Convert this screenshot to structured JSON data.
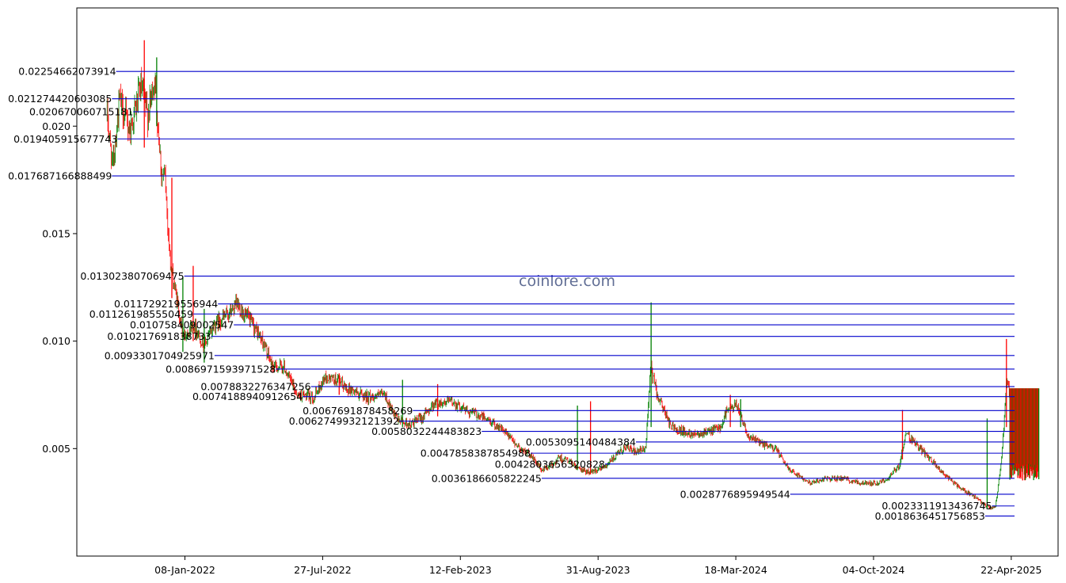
{
  "chart_data": {
    "type": "candlestick",
    "watermark": "coinlore.com",
    "colors": {
      "up": "#008000",
      "down": "#ff0000",
      "level": "#0000cc",
      "axis": "#000000"
    },
    "x_start": "2021-09-17",
    "x_end": "2025-06-01",
    "xlim": [
      "2021-08-04",
      "2025-06-29"
    ],
    "ylim": [
      0.0,
      0.0255
    ],
    "grid": false,
    "x_ticks": [
      {
        "date": "2022-01-08",
        "label": "08-Jan-2022"
      },
      {
        "date": "2022-07-27",
        "label": "27-Jul-2022"
      },
      {
        "date": "2023-02-12",
        "label": "12-Feb-2023"
      },
      {
        "date": "2023-08-31",
        "label": "31-Aug-2023"
      },
      {
        "date": "2024-03-18",
        "label": "18-Mar-2024"
      },
      {
        "date": "2024-10-04",
        "label": "04-Oct-2024"
      },
      {
        "date": "2025-04-22",
        "label": "22-Apr-2025"
      }
    ],
    "y_ticks": [
      {
        "value": 0.005,
        "label": "0.005"
      },
      {
        "value": 0.01,
        "label": "0.010"
      },
      {
        "value": 0.015,
        "label": "0.015"
      },
      {
        "value": 0.02,
        "label": "0.020"
      }
    ],
    "price_path": [
      [
        "2021-09-17",
        0.0205
      ],
      [
        "2021-09-25",
        0.0181
      ],
      [
        "2021-10-05",
        0.0212
      ],
      [
        "2021-10-20",
        0.0198
      ],
      [
        "2021-11-05",
        0.0218
      ],
      [
        "2021-11-15",
        0.0205
      ],
      [
        "2021-11-25",
        0.0222
      ],
      [
        "2021-12-05",
        0.0178
      ],
      [
        "2021-12-10",
        0.0176
      ],
      [
        "2021-12-18",
        0.0135
      ],
      [
        "2021-12-28",
        0.0118
      ],
      [
        "2022-01-05",
        0.0102
      ],
      [
        "2022-01-20",
        0.0108
      ],
      [
        "2022-02-05",
        0.0098
      ],
      [
        "2022-02-20",
        0.0108
      ],
      [
        "2022-03-10",
        0.0112
      ],
      [
        "2022-03-25",
        0.0117
      ],
      [
        "2022-04-15",
        0.0108
      ],
      [
        "2022-05-01",
        0.01
      ],
      [
        "2022-05-15",
        0.0088
      ],
      [
        "2022-06-01",
        0.0088
      ],
      [
        "2022-06-20",
        0.0075
      ],
      [
        "2022-07-15",
        0.0074
      ],
      [
        "2022-07-30",
        0.0083
      ],
      [
        "2022-08-15",
        0.0082
      ],
      [
        "2022-09-01",
        0.0078
      ],
      [
        "2022-10-01",
        0.0074
      ],
      [
        "2022-10-25",
        0.0075
      ],
      [
        "2022-11-10",
        0.0064
      ],
      [
        "2022-12-01",
        0.0061
      ],
      [
        "2022-12-20",
        0.0065
      ],
      [
        "2023-01-05",
        0.0071
      ],
      [
        "2023-01-30",
        0.0072
      ],
      [
        "2023-02-20",
        0.0068
      ],
      [
        "2023-03-15",
        0.0065
      ],
      [
        "2023-04-10",
        0.006
      ],
      [
        "2023-04-25",
        0.0055
      ],
      [
        "2023-05-10",
        0.005
      ],
      [
        "2023-05-25",
        0.0047
      ],
      [
        "2023-06-10",
        0.004
      ],
      [
        "2023-06-25",
        0.0042
      ],
      [
        "2023-07-05",
        0.0046
      ],
      [
        "2023-07-20",
        0.0044
      ],
      [
        "2023-08-05",
        0.004
      ],
      [
        "2023-08-20",
        0.0039
      ],
      [
        "2023-09-10",
        0.0042
      ],
      [
        "2023-09-25",
        0.0046
      ],
      [
        "2023-10-10",
        0.0051
      ],
      [
        "2023-10-25",
        0.0048
      ],
      [
        "2023-11-08",
        0.005
      ],
      [
        "2023-11-15",
        0.0088
      ],
      [
        "2023-11-25",
        0.0075
      ],
      [
        "2023-12-15",
        0.006
      ],
      [
        "2024-01-10",
        0.0057
      ],
      [
        "2024-02-10",
        0.0058
      ],
      [
        "2024-02-25",
        0.006
      ],
      [
        "2024-03-05",
        0.0068
      ],
      [
        "2024-03-20",
        0.007
      ],
      [
        "2024-04-05",
        0.0056
      ],
      [
        "2024-04-25",
        0.0052
      ],
      [
        "2024-05-15",
        0.005
      ],
      [
        "2024-05-30",
        0.0042
      ],
      [
        "2024-06-15",
        0.0038
      ],
      [
        "2024-07-05",
        0.0034
      ],
      [
        "2024-07-25",
        0.0036
      ],
      [
        "2024-08-20",
        0.0036
      ],
      [
        "2024-09-15",
        0.0034
      ],
      [
        "2024-10-10",
        0.0034
      ],
      [
        "2024-10-25",
        0.0036
      ],
      [
        "2024-11-10",
        0.0042
      ],
      [
        "2024-11-20",
        0.0057
      ],
      [
        "2024-12-05",
        0.0052
      ],
      [
        "2024-12-25",
        0.0045
      ],
      [
        "2025-01-15",
        0.0038
      ],
      [
        "2025-02-05",
        0.0032
      ],
      [
        "2025-02-25",
        0.0028
      ],
      [
        "2025-03-10",
        0.0025
      ],
      [
        "2025-03-22",
        0.0022
      ],
      [
        "2025-03-30",
        0.0023
      ],
      [
        "2025-04-08",
        0.0045
      ],
      [
        "2025-04-15",
        0.008
      ],
      [
        "2025-04-25",
        0.0072
      ],
      [
        "2025-05-10",
        0.006
      ],
      [
        "2025-05-25",
        0.004
      ],
      [
        "2025-06-01",
        0.0038
      ]
    ],
    "spikes": [
      {
        "date": "2021-11-10",
        "low": 0.019,
        "high": 0.024
      },
      {
        "date": "2021-11-28",
        "low": 0.02,
        "high": 0.0232
      },
      {
        "date": "2021-12-20",
        "low": 0.012,
        "high": 0.0176
      },
      {
        "date": "2022-01-05",
        "low": 0.0095,
        "high": 0.013
      },
      {
        "date": "2022-01-20",
        "low": 0.01,
        "high": 0.0135
      },
      {
        "date": "2022-02-05",
        "low": 0.009,
        "high": 0.0115
      },
      {
        "date": "2022-08-20",
        "low": 0.0075,
        "high": 0.0085
      },
      {
        "date": "2022-11-20",
        "low": 0.006,
        "high": 0.0082
      },
      {
        "date": "2023-01-10",
        "low": 0.0065,
        "high": 0.008
      },
      {
        "date": "2023-08-01",
        "low": 0.004,
        "high": 0.007
      },
      {
        "date": "2023-08-20",
        "low": 0.0038,
        "high": 0.0072
      },
      {
        "date": "2023-11-16",
        "low": 0.006,
        "high": 0.0118
      },
      {
        "date": "2024-03-10",
        "low": 0.006,
        "high": 0.0075
      },
      {
        "date": "2024-03-25",
        "low": 0.006,
        "high": 0.0073
      },
      {
        "date": "2024-11-15",
        "low": 0.0045,
        "high": 0.0068
      },
      {
        "date": "2025-03-18",
        "low": 0.0022,
        "high": 0.0064
      },
      {
        "date": "2025-04-15",
        "low": 0.006,
        "high": 0.0101
      }
    ],
    "band": {
      "start": "2025-04-20",
      "end": "2025-06-01",
      "low": 0.0035,
      "high": 0.0078
    },
    "levels": [
      {
        "value": 0.02254662073914,
        "label": "0.02254662073914",
        "label_end": "2021-09-30"
      },
      {
        "value": 0.021274420603085,
        "label": "0.021274420603085",
        "label_end": "2021-09-24"
      },
      {
        "value": 0.020670060715181,
        "label": "0.020670060715181",
        "label_end": "2021-10-25"
      },
      {
        "value": 0.019405915677743,
        "label": "0.019405915677743",
        "label_end": "2021-10-02"
      },
      {
        "value": 0.017687166888499,
        "label": "0.017687166888499",
        "label_end": "2021-09-24"
      },
      {
        "value": 0.013023807069475,
        "label": "0.013023807069475",
        "label_end": "2022-01-07"
      },
      {
        "value": 0.011729219556944,
        "label": "0.011729219556944",
        "label_end": "2022-02-25"
      },
      {
        "value": 0.011261985550459,
        "label": "0.011261985550459",
        "label_end": "2022-01-20"
      },
      {
        "value": 0.010758409002547,
        "label": "0.010758409002547",
        "label_end": "2022-03-20"
      },
      {
        "value": 0.010217691838733,
        "label": "0.010217691838733",
        "label_end": "2022-02-15"
      },
      {
        "value": 0.0093301704925971,
        "label": "0.0093301704925971",
        "label_end": "2022-02-20"
      },
      {
        "value": 0.0086971593971528,
        "label": "0.0086971593971528",
        "label_end": "2022-05-20"
      },
      {
        "value": 0.0078832276347256,
        "label": "0.0078832276347256",
        "label_end": "2022-07-10"
      },
      {
        "value": 0.0074188940912654,
        "label": "0.0074188940912654",
        "label_end": "2022-06-28"
      },
      {
        "value": 0.0067691878458269,
        "label": "0.0067691878458269",
        "label_end": "2022-12-05"
      },
      {
        "value": 0.0062749932121392,
        "label": "0.0062749932121392",
        "label_end": "2022-11-15"
      },
      {
        "value": 0.0058032244483823,
        "label": "0.0058032244483823",
        "label_end": "2023-03-15"
      },
      {
        "value": 0.0053095140484384,
        "label": "0.0053095140484384",
        "label_end": "2023-10-25"
      },
      {
        "value": 0.0047858387854988,
        "label": "0.0047858387854988",
        "label_end": "2023-05-25"
      },
      {
        "value": 0.0042803656320828,
        "label": "0.0042803656320828",
        "label_end": "2023-09-10"
      },
      {
        "value": 0.0036186605822245,
        "label": "0.0036186605822245",
        "label_end": "2023-06-10"
      },
      {
        "value": 0.0028776895949544,
        "label": "0.0028776895949544",
        "label_end": "2024-06-05"
      },
      {
        "value": 0.0023311913436745,
        "label": "0.0023311913436745",
        "label_end": "2025-03-25"
      },
      {
        "value": 0.0018636451756853,
        "label": "0.0018636451756853",
        "label_end": "2025-03-15"
      }
    ]
  }
}
